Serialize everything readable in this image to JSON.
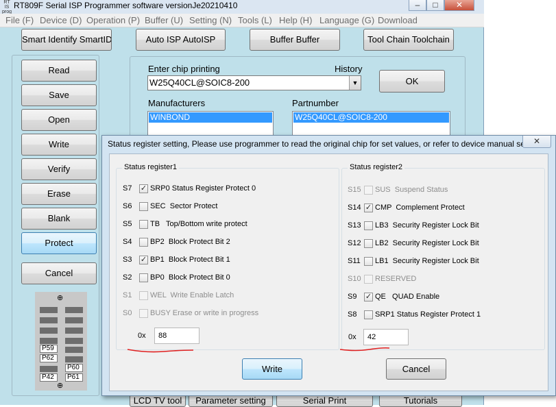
{
  "window": {
    "title": "RT809F Serial ISP Programmer software versionJe20210410",
    "app_icon_text": "RT IS prog",
    "minimize": "–",
    "maximize": "□",
    "close": "✕"
  },
  "menu": [
    "File (F)",
    "Device (D)",
    "Operation (P)",
    "Buffer (U)",
    "Setting (N)",
    "Tools (L)",
    "Help (H)",
    "Language (G)",
    "Download"
  ],
  "toolbar": {
    "smart_identify": "Smart Identify SmartID",
    "auto_isp": "Auto ISP AutoISP",
    "buffer": "Buffer Buffer",
    "tool_chain": "Tool Chain Toolchain"
  },
  "side_buttons": {
    "read": "Read",
    "save": "Save",
    "open": "Open",
    "write": "Write",
    "verify": "Verify",
    "erase": "Erase",
    "blank": "Blank",
    "protect": "Protect",
    "cancel": "Cancel"
  },
  "chip": {
    "enter_label": "Enter chip printing",
    "history_label": "History",
    "input_value": "W25Q40CL@SOIC8-200",
    "ok": "OK",
    "manufacturers_label": "Manufacturers",
    "partnumber_label": "Partnumber",
    "manufacturer_selected": "WINBOND",
    "partnumber_selected": "W25Q40CL@SOIC8-200"
  },
  "chip_graphic": {
    "top_mark": "⊕",
    "bottom_mark": "⊕",
    "pin_labels": [
      "P59",
      "P62",
      "P60",
      "P42",
      "P61"
    ]
  },
  "bottom_tabs": [
    "LCD TV tool",
    "Parameter setting",
    "Serial Print",
    "Tutorials"
  ],
  "dialog": {
    "title": "Status register setting, Please use programmer to read the original chip for set values, or refer to device manual se...",
    "close": "✕",
    "write": "Write",
    "cancel": "Cancel",
    "register1": {
      "title": "Status register1",
      "rows": [
        {
          "id": "S7",
          "label": "SRP0 Status Register Protect 0",
          "checked": true,
          "enabled": true
        },
        {
          "id": "S6",
          "label": "SEC  Sector Protect",
          "checked": false,
          "enabled": true
        },
        {
          "id": "S5",
          "label": "TB   Top/Bottom write protect",
          "checked": false,
          "enabled": true
        },
        {
          "id": "S4",
          "label": "BP2  Block Protect Bit 2",
          "checked": false,
          "enabled": true
        },
        {
          "id": "S3",
          "label": "BP1  Block Protect Bit 1",
          "checked": true,
          "enabled": true
        },
        {
          "id": "S2",
          "label": "BP0  Block Protect Bit 0",
          "checked": false,
          "enabled": true
        },
        {
          "id": "S1",
          "label": "WEL  Write Enable Latch",
          "checked": false,
          "enabled": false
        },
        {
          "id": "S0",
          "label": "BUSY Erase or write in progress",
          "checked": false,
          "enabled": false
        }
      ],
      "hex_prefix": "0x",
      "hex_value": "88"
    },
    "register2": {
      "title": "Status register2",
      "rows": [
        {
          "id": "S15",
          "label": "SUS  Suspend Status",
          "checked": false,
          "enabled": false
        },
        {
          "id": "S14",
          "label": "CMP  Complement Protect",
          "checked": true,
          "enabled": true
        },
        {
          "id": "S13",
          "label": "LB3  Security Register Lock Bit",
          "checked": false,
          "enabled": true
        },
        {
          "id": "S12",
          "label": "LB2  Security Register Lock Bit",
          "checked": false,
          "enabled": true
        },
        {
          "id": "S11",
          "label": "LB1  Security Register Lock Bit",
          "checked": false,
          "enabled": true
        },
        {
          "id": "S10",
          "label": "RESERVED",
          "checked": false,
          "enabled": false
        },
        {
          "id": "S9",
          "label": "QE   QUAD Enable",
          "checked": true,
          "enabled": true
        },
        {
          "id": "S8",
          "label": "SRP1 Status Register Protect 1",
          "checked": false,
          "enabled": true
        }
      ],
      "hex_prefix": "0x",
      "hex_value": "42"
    }
  },
  "colors": {
    "main_bg": "#bfe0ea",
    "selection": "#3399ff",
    "annotation": "#e02020"
  }
}
